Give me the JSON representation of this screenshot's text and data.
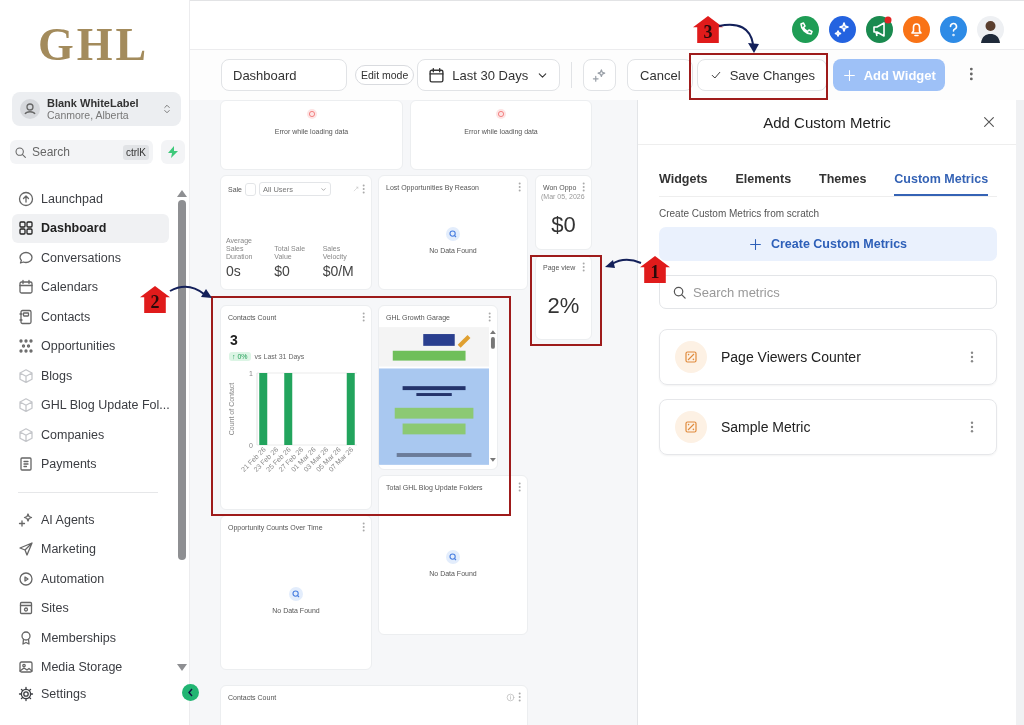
{
  "logo": {
    "text": "GHL"
  },
  "account": {
    "name": "Blank WhiteLabel",
    "location": "Canmore, Alberta"
  },
  "sidebar_search": {
    "placeholder": "Search",
    "shortcut": "ctrlK"
  },
  "sidebar": {
    "sections": [
      {
        "items": [
          {
            "label": "Launchpad",
            "selected": false
          },
          {
            "label": "Dashboard",
            "selected": true
          },
          {
            "label": "Conversations",
            "selected": false
          },
          {
            "label": "Calendars",
            "selected": false
          },
          {
            "label": "Contacts",
            "selected": false
          },
          {
            "label": "Opportunities",
            "selected": false
          },
          {
            "label": "Blogs",
            "selected": false
          },
          {
            "label": "GHL Blog Update Fol...",
            "selected": false
          },
          {
            "label": "Companies",
            "selected": false
          },
          {
            "label": "Payments",
            "selected": false
          }
        ]
      },
      {
        "items": [
          {
            "label": "AI Agents",
            "selected": false
          },
          {
            "label": "Marketing",
            "selected": false
          },
          {
            "label": "Automation",
            "selected": false
          },
          {
            "label": "Sites",
            "selected": false
          },
          {
            "label": "Memberships",
            "selected": false
          },
          {
            "label": "Media Storage",
            "selected": false
          }
        ]
      }
    ],
    "footer": {
      "label": "Settings"
    }
  },
  "toolbar": {
    "dashboard_name": "Dashboard",
    "mode_badge": "Edit mode",
    "date_range": "Last 30 Days",
    "buttons": [
      {
        "label": "Cancel",
        "kind": "secondary",
        "disabled": false
      },
      {
        "label": "Save Changes",
        "kind": "save",
        "disabled": false
      },
      {
        "label": "Add Widget",
        "kind": "primary",
        "disabled": true
      }
    ]
  },
  "widgets": [
    {
      "kind": "error",
      "message": "Error while loading data"
    },
    {
      "kind": "error",
      "message": "Error while loading data"
    },
    {
      "kind": "sales",
      "title": "Sale",
      "filter": "All Users",
      "stats": [
        {
          "label": "Average Sales Duration",
          "value": "0s"
        },
        {
          "label": "Total Sale Value",
          "value": "$0"
        },
        {
          "label": "Sales Velocity",
          "value": "$0/M"
        }
      ]
    },
    {
      "kind": "no_data",
      "title": "Lost Opportunities By Reason",
      "message": "No Data Found"
    },
    {
      "kind": "stat",
      "title": "Won Oppo",
      "subtitle": "(Mar 05, 2026",
      "value": "$0"
    },
    {
      "kind": "stat",
      "title": "Page view",
      "value": "2%"
    },
    {
      "kind": "chart",
      "title": "Contacts Count",
      "value": "3",
      "change": "↑ 0%",
      "comparison": "vs Last 31 Days",
      "chart_data": {
        "type": "bar",
        "ylabel": "Count of Contact",
        "categories": [
          "21 Feb 26",
          "23 Feb 26",
          "25 Feb 26",
          "27 Feb 26",
          "01 Mar 26",
          "03 Mar 26",
          "05 Mar 26",
          "07 Mar 26"
        ],
        "values": [
          1,
          0,
          1,
          0,
          0,
          0,
          0,
          1
        ],
        "ylim": [
          0,
          1
        ],
        "yticks": [
          0,
          1
        ]
      }
    },
    {
      "kind": "picture",
      "title": "GHL Growth Garage"
    },
    {
      "kind": "no_data",
      "title": "Total GHL Blog Update Folders",
      "message": "No Data Found"
    },
    {
      "kind": "no_data",
      "title": "Opportunity Counts Over Time",
      "message": "No Data Found"
    },
    {
      "kind": "header",
      "title": "Contacts Count"
    }
  ],
  "panel": {
    "title": "Add Custom Metric",
    "tabs": [
      {
        "label": "Widgets",
        "selected": false
      },
      {
        "label": "Elements",
        "selected": false
      },
      {
        "label": "Themes",
        "selected": false
      },
      {
        "label": "Custom Metrics",
        "selected": true
      }
    ],
    "description": "Create Custom Metrics from scratch",
    "create_button": "Create Custom Metrics",
    "search": {
      "placeholder": "Search metrics"
    },
    "metrics": [
      {
        "name": "Page Viewers Counter"
      },
      {
        "name": "Sample Metric"
      }
    ]
  },
  "annotations": [
    {
      "label": "1"
    },
    {
      "label": "2"
    },
    {
      "label": "3"
    }
  ]
}
